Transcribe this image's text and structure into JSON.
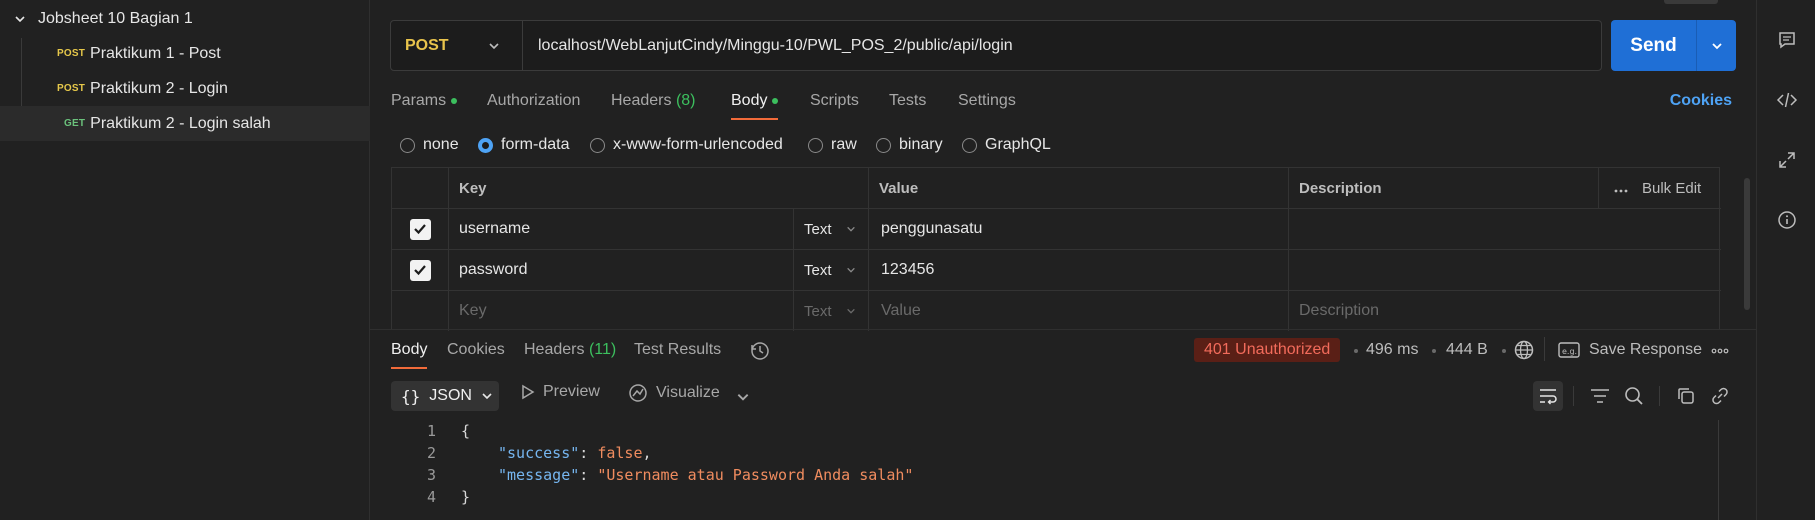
{
  "sidebar": {
    "collection_name": "Jobsheet 10 Bagian 1",
    "items": [
      {
        "method": "POST",
        "name": "Praktikum 1 - Post"
      },
      {
        "method": "POST",
        "name": "Praktikum 2 - Login"
      },
      {
        "method": "GET",
        "name": "Praktikum 2 - Login salah"
      }
    ]
  },
  "request": {
    "method": "POST",
    "url": "localhost/WebLanjutCindy/Minggu-10/PWL_POS_2/public/api/login",
    "send_label": "Send"
  },
  "request_tabs": {
    "params": "Params",
    "authorization": "Authorization",
    "headers": "Headers",
    "headers_count": "(8)",
    "body": "Body",
    "scripts": "Scripts",
    "tests": "Tests",
    "settings": "Settings",
    "cookies": "Cookies"
  },
  "body_types": {
    "none": "none",
    "form_data": "form-data",
    "urlencoded": "x-www-form-urlencoded",
    "raw": "raw",
    "binary": "binary",
    "graphql": "GraphQL",
    "selected": "form-data"
  },
  "form_table": {
    "headers": {
      "key": "Key",
      "value": "Value",
      "description": "Description",
      "bulk_edit": "Bulk Edit"
    },
    "rows": [
      {
        "checked": true,
        "key": "username",
        "type": "Text",
        "value": "penggunasatu",
        "description": ""
      },
      {
        "checked": true,
        "key": "password",
        "type": "Text",
        "value": "123456",
        "description": ""
      }
    ],
    "placeholder": {
      "key": "Key",
      "type": "Text",
      "value": "Value",
      "description": "Description"
    }
  },
  "response": {
    "tabs": {
      "body": "Body",
      "cookies": "Cookies",
      "headers": "Headers",
      "headers_count": "(11)",
      "test_results": "Test Results"
    },
    "status": "401 Unauthorized",
    "time": "496 ms",
    "size": "444 B",
    "save_response": "Save Response",
    "format": "JSON",
    "preview": "Preview",
    "visualize": "Visualize",
    "code": {
      "line_numbers": [
        "1",
        "2",
        "3",
        "4"
      ],
      "open_brace": "{",
      "close_brace": "}",
      "success_key": "\"success\"",
      "success_value": "false",
      "message_key": "\"message\"",
      "message_value": "\"Username atau Password Anda salah\""
    }
  },
  "colors": {
    "send_button": "#1f6fd6",
    "post_method": "#e6c84a",
    "get_method": "#6bc27c",
    "active_tab_underline": "#f26b3a",
    "status_error": "#f26b5b",
    "json_key": "#76b6f0",
    "json_value": "#f08c5f"
  }
}
